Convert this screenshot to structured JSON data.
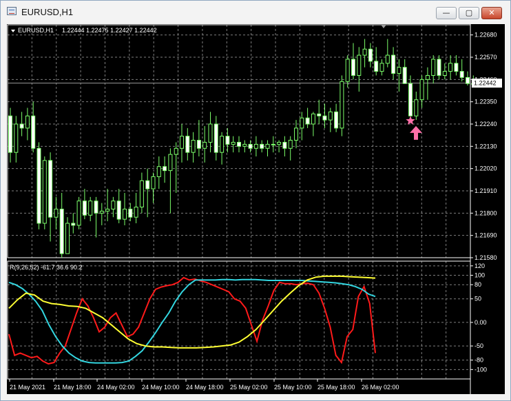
{
  "window": {
    "title": "EURUSD,H1",
    "buttons": {
      "minimize": "—",
      "maximize": "▢",
      "close": "✕"
    }
  },
  "colors": {
    "background": "#000000",
    "grid": "#7f7f7f",
    "candle": "#7cff6a",
    "text": "#ffffff",
    "signal": "#ff6fa9",
    "red_line": "#ff1a1a",
    "cyan_line": "#33d6e0",
    "yellow_line": "#ffff33"
  },
  "main_panel": {
    "symbol_label": "EURUSD,H1",
    "ohlc_label": "1.22444 1.22475 1.22427 1.22442",
    "current_price_label": "1.22442",
    "signal_icons": [
      "star-icon",
      "arrow-up-icon"
    ]
  },
  "indicator_panel": {
    "label": "R(9,26,52) -61.7 36.6 90.2"
  },
  "chart_data": [
    {
      "type": "candlestick",
      "title": "EURUSD,H1",
      "y_ticks": [
        "1.22680",
        "1.22570",
        "1.22460",
        "1.22350",
        "1.22240",
        "1.22130",
        "1.22020",
        "1.21910",
        "1.21800",
        "1.21690",
        "1.21580"
      ],
      "ylim": [
        1.2158,
        1.2273
      ],
      "x_ticks": [
        "21 May 2021",
        "21 May 18:00",
        "24 May 02:00",
        "24 May 10:00",
        "24 May 18:00",
        "25 May 02:00",
        "25 May 10:00",
        "25 May 18:00",
        "26 May 02:00"
      ],
      "last_price": 1.22442,
      "candles": [
        [
          1.2228,
          1.2232,
          1.2205,
          1.221
        ],
        [
          1.221,
          1.2228,
          1.2205,
          1.2224
        ],
        [
          1.2224,
          1.223,
          1.2218,
          1.2222
        ],
        [
          1.2222,
          1.2232,
          1.2216,
          1.2228
        ],
        [
          1.2228,
          1.2235,
          1.221,
          1.2212
        ],
        [
          1.2212,
          1.2215,
          1.2172,
          1.2175
        ],
        [
          1.2175,
          1.2208,
          1.2172,
          1.2206
        ],
        [
          1.2206,
          1.221,
          1.2166,
          1.2178
        ],
        [
          1.2178,
          1.2188,
          1.2172,
          1.2182
        ],
        [
          1.2182,
          1.219,
          1.2158,
          1.216
        ],
        [
          1.216,
          1.2178,
          1.2162,
          1.2175
        ],
        [
          1.2175,
          1.218,
          1.217,
          1.2174
        ],
        [
          1.2174,
          1.2188,
          1.2172,
          1.2186
        ],
        [
          1.2186,
          1.2192,
          1.2177,
          1.2179
        ],
        [
          1.2179,
          1.2188,
          1.2176,
          1.2186
        ],
        [
          1.2186,
          1.2188,
          1.2168,
          1.218
        ],
        [
          1.218,
          1.2185,
          1.2174,
          1.2181
        ],
        [
          1.2181,
          1.2192,
          1.2176,
          1.2182
        ],
        [
          1.2182,
          1.2188,
          1.2178,
          1.2186
        ],
        [
          1.2186,
          1.2192,
          1.2175,
          1.2177
        ],
        [
          1.2177,
          1.219,
          1.2174,
          1.2182
        ],
        [
          1.2182,
          1.2185,
          1.2176,
          1.2178
        ],
        [
          1.2178,
          1.219,
          1.2175,
          1.2183
        ],
        [
          1.2183,
          1.22,
          1.218,
          1.2196
        ],
        [
          1.2196,
          1.2202,
          1.2178,
          1.2192
        ],
        [
          1.2192,
          1.22,
          1.2185,
          1.2198
        ],
        [
          1.2198,
          1.2208,
          1.2192,
          1.2203
        ],
        [
          1.2203,
          1.2208,
          1.2195,
          1.2201
        ],
        [
          1.2201,
          1.2212,
          1.218,
          1.2209
        ],
        [
          1.2209,
          1.2215,
          1.219,
          1.2212
        ],
        [
          1.2212,
          1.2224,
          1.2205,
          1.2218
        ],
        [
          1.2218,
          1.2222,
          1.2206,
          1.221
        ],
        [
          1.221,
          1.222,
          1.2205,
          1.2216
        ],
        [
          1.2216,
          1.2226,
          1.2208,
          1.2212
        ],
        [
          1.2212,
          1.2223,
          1.2205,
          1.2215
        ],
        [
          1.2215,
          1.223,
          1.221,
          1.2224
        ],
        [
          1.2224,
          1.2228,
          1.2206,
          1.221
        ],
        [
          1.221,
          1.222,
          1.2204,
          1.2218
        ],
        [
          1.2218,
          1.2222,
          1.221,
          1.2214
        ],
        [
          1.2214,
          1.2218,
          1.221,
          1.2215
        ],
        [
          1.2215,
          1.2218,
          1.221,
          1.2213
        ],
        [
          1.2213,
          1.2216,
          1.221,
          1.2214
        ],
        [
          1.2214,
          1.2216,
          1.221,
          1.2212
        ],
        [
          1.2212,
          1.2218,
          1.2208,
          1.2214
        ],
        [
          1.2214,
          1.2216,
          1.221,
          1.2212
        ],
        [
          1.2212,
          1.2216,
          1.2208,
          1.2214
        ],
        [
          1.2214,
          1.2218,
          1.221,
          1.2214
        ],
        [
          1.2214,
          1.2216,
          1.221,
          1.2215
        ],
        [
          1.2215,
          1.2218,
          1.2208,
          1.2212
        ],
        [
          1.2212,
          1.2218,
          1.2206,
          1.2216
        ],
        [
          1.2216,
          1.2226,
          1.2212,
          1.2222
        ],
        [
          1.2222,
          1.223,
          1.2216,
          1.2227
        ],
        [
          1.2227,
          1.2232,
          1.2222,
          1.2224
        ],
        [
          1.2224,
          1.223,
          1.2218,
          1.2229
        ],
        [
          1.2229,
          1.2236,
          1.2224,
          1.2228
        ],
        [
          1.2228,
          1.2234,
          1.2222,
          1.2226
        ],
        [
          1.2226,
          1.2232,
          1.222,
          1.223
        ],
        [
          1.223,
          1.2234,
          1.222,
          1.2222
        ],
        [
          1.2222,
          1.2248,
          1.2218,
          1.2245
        ],
        [
          1.2245,
          1.2258,
          1.2242,
          1.2256
        ],
        [
          1.2256,
          1.2264,
          1.2246,
          1.2248
        ],
        [
          1.2248,
          1.2262,
          1.224,
          1.2258
        ],
        [
          1.2258,
          1.2266,
          1.2252,
          1.2261
        ],
        [
          1.2261,
          1.2264,
          1.2252,
          1.2255
        ],
        [
          1.2255,
          1.2262,
          1.2248,
          1.225
        ],
        [
          1.225,
          1.2256,
          1.2248,
          1.2254
        ],
        [
          1.2254,
          1.2266,
          1.2252,
          1.2258
        ],
        [
          1.2258,
          1.2262,
          1.2246,
          1.2249
        ],
        [
          1.2249,
          1.2256,
          1.224,
          1.2252
        ],
        [
          1.2252,
          1.2256,
          1.2244,
          1.2244
        ],
        [
          1.2244,
          1.2248,
          1.2225,
          1.2228
        ],
        [
          1.2228,
          1.224,
          1.2226,
          1.2236
        ],
        [
          1.2236,
          1.2248,
          1.2232,
          1.2246
        ],
        [
          1.2246,
          1.2252,
          1.2236,
          1.2248
        ],
        [
          1.2248,
          1.2258,
          1.2244,
          1.2256
        ],
        [
          1.2256,
          1.2258,
          1.2246,
          1.2248
        ],
        [
          1.2248,
          1.2254,
          1.2246,
          1.225
        ],
        [
          1.225,
          1.2258,
          1.2246,
          1.2254
        ],
        [
          1.2254,
          1.2258,
          1.2248,
          1.225
        ],
        [
          1.225,
          1.2256,
          1.2245,
          1.2247
        ],
        [
          1.2247,
          1.225,
          1.2243,
          1.2244
        ],
        [
          1.2244,
          1.2248,
          1.2243,
          1.2244
        ]
      ],
      "signals": [
        {
          "type": "star",
          "candle_index": 70,
          "price": 1.22256
        },
        {
          "type": "arrow-up",
          "candle_index": 70,
          "price": 1.2221
        }
      ]
    },
    {
      "type": "line",
      "title": "R(9,26,52) -61.7 36.6 90.2",
      "y_ticks": [
        "120",
        "100",
        "80",
        "50",
        "0.00",
        "-50",
        "-80",
        "-100"
      ],
      "ylim": [
        -120,
        130
      ],
      "series": [
        {
          "color": "red",
          "values": [
            -25,
            -70,
            -65,
            -70,
            -75,
            -72,
            -82,
            -88,
            -85,
            -65,
            -50,
            -15,
            20,
            50,
            35,
            10,
            -20,
            -10,
            10,
            20,
            -5,
            -30,
            -25,
            -10,
            20,
            50,
            70,
            75,
            78,
            80,
            85,
            95,
            90,
            92,
            88,
            85,
            80,
            75,
            70,
            65,
            50,
            45,
            30,
            -5,
            -40,
            5,
            35,
            68,
            85,
            82,
            82,
            80,
            82,
            83,
            80,
            62,
            30,
            -10,
            -70,
            -85,
            -30,
            -15,
            55,
            76,
            40,
            -65
          ]
        },
        {
          "color": "cyan",
          "values": [
            85,
            80,
            72,
            60,
            45,
            25,
            -5,
            -30,
            -50,
            -65,
            -75,
            -82,
            -85,
            -86,
            -86,
            -86,
            -86,
            -85,
            -82,
            -72,
            -60,
            -42,
            -22,
            0,
            20,
            45,
            65,
            80,
            90,
            90,
            90,
            90,
            91,
            91,
            90,
            91,
            91,
            91,
            90,
            89,
            89,
            89,
            89,
            89,
            89,
            88,
            87,
            86,
            85,
            84,
            82,
            80,
            76,
            70,
            60,
            55
          ]
        },
        {
          "color": "yellow",
          "values": [
            30,
            48,
            62,
            58,
            45,
            40,
            38,
            35,
            34,
            30,
            20,
            10,
            -5,
            -20,
            -35,
            -45,
            -50,
            -52,
            -52,
            -53,
            -54,
            -54,
            -54,
            -53,
            -52,
            -50,
            -48,
            -42,
            -30,
            -15,
            5,
            25,
            45,
            62,
            78,
            90,
            96,
            98,
            98,
            98,
            97,
            96,
            95,
            94
          ]
        }
      ],
      "x_ticks": [
        "21 May 2021",
        "21 May 18:00",
        "24 May 02:00",
        "24 May 10:00",
        "24 May 18:00",
        "25 May 02:00",
        "25 May 10:00",
        "25 May 18:00",
        "26 May 02:00"
      ]
    }
  ]
}
